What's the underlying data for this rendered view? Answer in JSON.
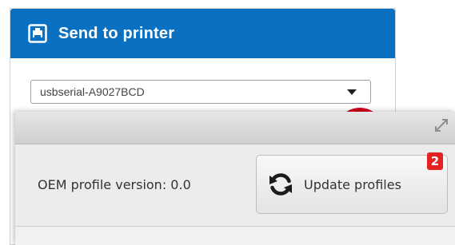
{
  "send_panel": {
    "title": "Send to printer",
    "printer_select": {
      "selected": "usbserial-A9027BCD"
    }
  },
  "overlay": {
    "oem_profile_label": "OEM profile version: 0.0",
    "update_button_label": "Update profiles",
    "update_badge_count": "2"
  },
  "colors": {
    "header_blue": "#0a70c2",
    "badge_red": "#e52222",
    "indicator_red": "#d6001c"
  },
  "icons": [
    "printer-icon",
    "chevron-down-icon",
    "resize-icon",
    "refresh-icon"
  ]
}
